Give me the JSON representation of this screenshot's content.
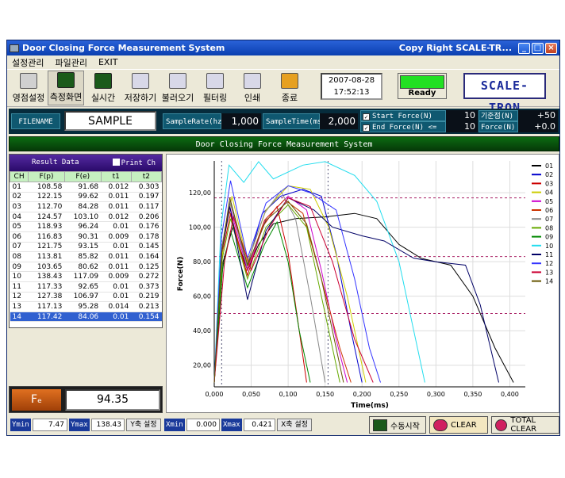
{
  "window": {
    "title": "Door Closing Force Measurement System",
    "copyright": "Copy Right SCALE-TR...",
    "controls": {
      "min": "_",
      "max": "□",
      "close": "×"
    }
  },
  "menu": [
    "설정관리",
    "파일관리",
    "EXIT"
  ],
  "toolbar": [
    {
      "label": "영점설정",
      "icon": "zero-set-icon"
    },
    {
      "label": "측정화면",
      "icon": "measure-screen-icon",
      "active": true
    },
    {
      "label": "실시간",
      "icon": "realtime-icon"
    },
    {
      "label": "저장하기",
      "icon": "save-icon"
    },
    {
      "label": "불러오기",
      "icon": "load-icon"
    },
    {
      "label": "필터링",
      "icon": "filter-icon"
    },
    {
      "label": "인쇄",
      "icon": "print-icon"
    },
    {
      "label": "종료",
      "icon": "exit-icon"
    }
  ],
  "datetime": {
    "date": "2007-08-28",
    "time": "17:52:13"
  },
  "status": {
    "label": "Ready",
    "lamp_color": "#22e022"
  },
  "logo": "SCALE-TRON",
  "params": {
    "filename_label": "FILENAME",
    "filename": "SAMPLE",
    "sample_rate_label": "SampleRate(hz)",
    "sample_rate": "1,000",
    "sample_time_label": "SampleTime(ms)",
    "sample_time": "2,000",
    "start_label": "Start  Force(N) >=",
    "start_value": "10",
    "end_label": "End    Force(N) <=",
    "end_value": "10",
    "ref_label": "기준점(N)",
    "ref_value": "+50",
    "force_label": "Force(N)",
    "force_value": "+0.0"
  },
  "banner": "Door Closing Force Measurement System",
  "result": {
    "title": "Result Data",
    "print_label": "Print Ch",
    "columns": [
      "CH",
      "F(p)",
      "F(e)",
      "t1",
      "t2"
    ],
    "rows": [
      [
        "01",
        "108.58",
        "91.68",
        "0.012",
        "0.303"
      ],
      [
        "02",
        "122.15",
        "99.62",
        "0.011",
        "0.197"
      ],
      [
        "03",
        "112.70",
        "84.28",
        "0.011",
        "0.117"
      ],
      [
        "04",
        "124.57",
        "103.10",
        "0.012",
        "0.206"
      ],
      [
        "05",
        "118.93",
        "96.24",
        "0.01",
        "0.176"
      ],
      [
        "06",
        "116.83",
        "90.31",
        "0.009",
        "0.178"
      ],
      [
        "07",
        "121.75",
        "93.15",
        "0.01",
        "0.145"
      ],
      [
        "08",
        "113.81",
        "85.82",
        "0.011",
        "0.164"
      ],
      [
        "09",
        "103.65",
        "80.62",
        "0.011",
        "0.125"
      ],
      [
        "10",
        "138.43",
        "117.09",
        "0.009",
        "0.272"
      ],
      [
        "11",
        "117.33",
        "92.65",
        "0.01",
        "0.373"
      ],
      [
        "12",
        "127.38",
        "106.97",
        "0.01",
        "0.219"
      ],
      [
        "13",
        "117.13",
        "95.28",
        "0.014",
        "0.213"
      ],
      [
        "14",
        "117.42",
        "84.06",
        "0.01",
        "0.154"
      ]
    ],
    "selected_row": 13
  },
  "fe": {
    "label": "Fₑ",
    "value": "94.35"
  },
  "bottom": {
    "ymin_label": "Ymin",
    "ymin": "7.47",
    "ymax_label": "Ymax",
    "ymax": "138.43",
    "y_set": "Y축 설정",
    "xmin_label": "Xmin",
    "xmin": "0.000",
    "xmax_label": "Xmax",
    "xmax": "0.421",
    "x_set": "X축 설정",
    "manual_start": "수동시작",
    "clear": "CLEAR",
    "total_clear": "TOTAL CLEAR"
  },
  "chart_data": {
    "type": "line",
    "xlabel": "Time(ms)",
    "ylabel": "Force(N)",
    "xlim": [
      0,
      0.421
    ],
    "ylim": [
      7.47,
      138.43
    ],
    "xticks": [
      "0,000",
      "0,050",
      "0,100",
      "0,150",
      "0,200",
      "0,250",
      "0,300",
      "0,350",
      "0,400"
    ],
    "xtick_values": [
      0,
      0.05,
      0.1,
      0.15,
      0.2,
      0.25,
      0.3,
      0.35,
      0.4
    ],
    "yticks": [
      "20,00",
      "40,00",
      "60,00",
      "80,00",
      "100,00",
      "120,00"
    ],
    "ytick_values": [
      20,
      40,
      60,
      80,
      100,
      120
    ],
    "hlines": [
      117,
      83,
      50
    ],
    "vlines": [
      0.01,
      0.154
    ],
    "legend_position": "right",
    "series": [
      {
        "name": "01",
        "color": "#000000",
        "points": [
          [
            0,
            10
          ],
          [
            0.012,
            80
          ],
          [
            0.025,
            100
          ],
          [
            0.045,
            75
          ],
          [
            0.06,
            90
          ],
          [
            0.08,
            102
          ],
          [
            0.11,
            105
          ],
          [
            0.15,
            106
          ],
          [
            0.19,
            108
          ],
          [
            0.22,
            105
          ],
          [
            0.25,
            90
          ],
          [
            0.28,
            82
          ],
          [
            0.32,
            78
          ],
          [
            0.35,
            60
          ],
          [
            0.38,
            30
          ],
          [
            0.405,
            10
          ]
        ]
      },
      {
        "name": "02",
        "color": "#0000cc",
        "points": [
          [
            0,
            10
          ],
          [
            0.011,
            90
          ],
          [
            0.022,
            115
          ],
          [
            0.045,
            78
          ],
          [
            0.065,
            108
          ],
          [
            0.09,
            118
          ],
          [
            0.12,
            122
          ],
          [
            0.145,
            118
          ],
          [
            0.165,
            85
          ],
          [
            0.185,
            40
          ],
          [
            0.2,
            10
          ]
        ]
      },
      {
        "name": "03",
        "color": "#cc0000",
        "points": [
          [
            0,
            10
          ],
          [
            0.011,
            85
          ],
          [
            0.022,
            108
          ],
          [
            0.045,
            72
          ],
          [
            0.065,
            100
          ],
          [
            0.085,
            112
          ],
          [
            0.1,
            85
          ],
          [
            0.115,
            40
          ],
          [
            0.125,
            10
          ]
        ]
      },
      {
        "name": "04",
        "color": "#cccc00",
        "points": [
          [
            0,
            10
          ],
          [
            0.012,
            90
          ],
          [
            0.024,
            118
          ],
          [
            0.045,
            80
          ],
          [
            0.07,
            110
          ],
          [
            0.1,
            124
          ],
          [
            0.13,
            122
          ],
          [
            0.155,
            100
          ],
          [
            0.18,
            60
          ],
          [
            0.205,
            10
          ]
        ]
      },
      {
        "name": "05",
        "color": "#cc00cc",
        "points": [
          [
            0,
            10
          ],
          [
            0.01,
            85
          ],
          [
            0.021,
            112
          ],
          [
            0.045,
            75
          ],
          [
            0.07,
            105
          ],
          [
            0.1,
            118
          ],
          [
            0.125,
            110
          ],
          [
            0.145,
            75
          ],
          [
            0.165,
            35
          ],
          [
            0.18,
            10
          ]
        ]
      },
      {
        "name": "06",
        "color": "#cc3300",
        "points": [
          [
            0,
            10
          ],
          [
            0.009,
            85
          ],
          [
            0.02,
            110
          ],
          [
            0.043,
            74
          ],
          [
            0.068,
            104
          ],
          [
            0.095,
            116
          ],
          [
            0.12,
            108
          ],
          [
            0.145,
            70
          ],
          [
            0.17,
            30
          ],
          [
            0.185,
            10
          ]
        ]
      },
      {
        "name": "07",
        "color": "#888888",
        "points": [
          [
            0,
            10
          ],
          [
            0.01,
            88
          ],
          [
            0.021,
            115
          ],
          [
            0.044,
            78
          ],
          [
            0.068,
            108
          ],
          [
            0.09,
            121
          ],
          [
            0.11,
            105
          ],
          [
            0.13,
            60
          ],
          [
            0.15,
            10
          ]
        ]
      },
      {
        "name": "08",
        "color": "#66aa00",
        "points": [
          [
            0,
            10
          ],
          [
            0.011,
            82
          ],
          [
            0.022,
            105
          ],
          [
            0.045,
            70
          ],
          [
            0.07,
            100
          ],
          [
            0.1,
            113
          ],
          [
            0.125,
            100
          ],
          [
            0.145,
            60
          ],
          [
            0.16,
            30
          ],
          [
            0.17,
            10
          ]
        ]
      },
      {
        "name": "09",
        "color": "#008800",
        "points": [
          [
            0,
            10
          ],
          [
            0.011,
            75
          ],
          [
            0.022,
            98
          ],
          [
            0.045,
            65
          ],
          [
            0.068,
            90
          ],
          [
            0.085,
            103
          ],
          [
            0.1,
            80
          ],
          [
            0.115,
            40
          ],
          [
            0.13,
            10
          ]
        ]
      },
      {
        "name": "10",
        "color": "#22ddee",
        "points": [
          [
            0,
            10
          ],
          [
            0.009,
            100
          ],
          [
            0.02,
            136
          ],
          [
            0.04,
            126
          ],
          [
            0.06,
            138
          ],
          [
            0.08,
            128
          ],
          [
            0.12,
            136
          ],
          [
            0.15,
            138
          ],
          [
            0.19,
            130
          ],
          [
            0.22,
            115
          ],
          [
            0.25,
            80
          ],
          [
            0.27,
            40
          ],
          [
            0.285,
            10
          ]
        ]
      },
      {
        "name": "11",
        "color": "#000066",
        "points": [
          [
            0,
            10
          ],
          [
            0.01,
            85
          ],
          [
            0.021,
            112
          ],
          [
            0.045,
            58
          ],
          [
            0.07,
            98
          ],
          [
            0.1,
            117
          ],
          [
            0.135,
            110
          ],
          [
            0.16,
            100
          ],
          [
            0.2,
            95
          ],
          [
            0.23,
            92
          ],
          [
            0.27,
            82
          ],
          [
            0.3,
            80
          ],
          [
            0.34,
            78
          ],
          [
            0.36,
            55
          ],
          [
            0.385,
            10
          ]
        ]
      },
      {
        "name": "12",
        "color": "#3333ff",
        "points": [
          [
            0,
            10
          ],
          [
            0.01,
            95
          ],
          [
            0.022,
            127
          ],
          [
            0.045,
            82
          ],
          [
            0.07,
            114
          ],
          [
            0.1,
            124
          ],
          [
            0.13,
            120
          ],
          [
            0.165,
            110
          ],
          [
            0.19,
            70
          ],
          [
            0.21,
            30
          ],
          [
            0.225,
            10
          ]
        ]
      },
      {
        "name": "13",
        "color": "#cc0033",
        "points": [
          [
            0,
            10
          ],
          [
            0.014,
            80
          ],
          [
            0.026,
            106
          ],
          [
            0.05,
            75
          ],
          [
            0.075,
            100
          ],
          [
            0.1,
            117
          ],
          [
            0.13,
            112
          ],
          [
            0.16,
            80
          ],
          [
            0.19,
            35
          ],
          [
            0.215,
            10
          ]
        ]
      },
      {
        "name": "14",
        "color": "#665500",
        "points": [
          [
            0,
            10
          ],
          [
            0.01,
            85
          ],
          [
            0.021,
            117
          ],
          [
            0.045,
            78
          ],
          [
            0.07,
            104
          ],
          [
            0.1,
            115
          ],
          [
            0.125,
            102
          ],
          [
            0.145,
            70
          ],
          [
            0.165,
            30
          ],
          [
            0.175,
            10
          ]
        ]
      }
    ]
  }
}
